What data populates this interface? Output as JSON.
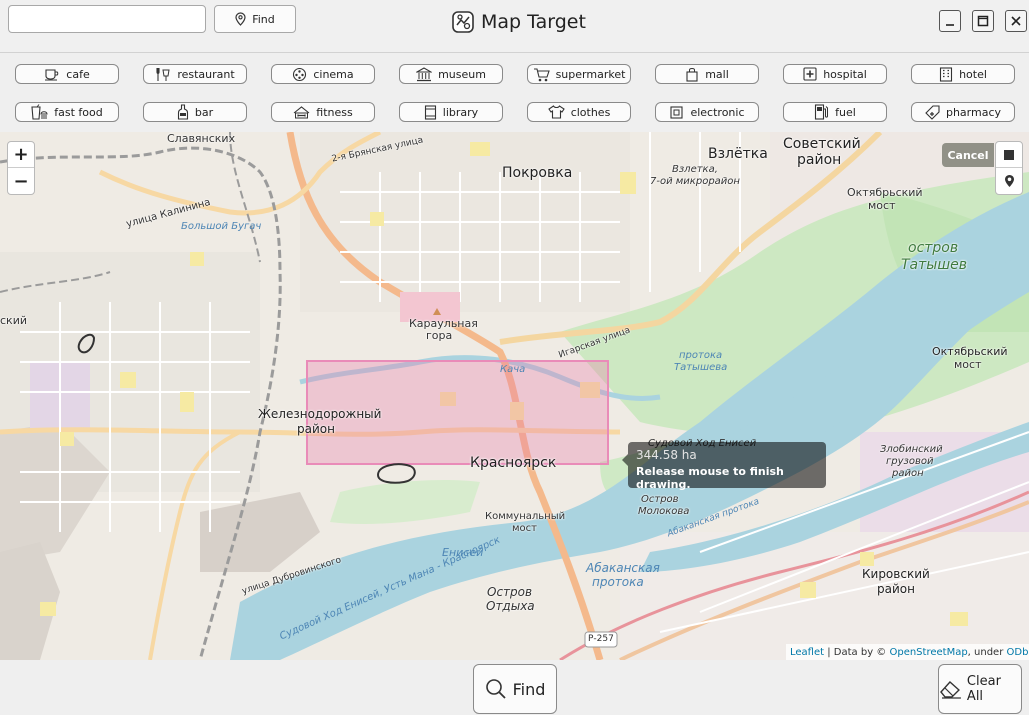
{
  "app": {
    "title": "Map Target"
  },
  "search": {
    "value": "",
    "placeholder": "",
    "find_label": "Find"
  },
  "categories": [
    {
      "label": "cafe",
      "icon": "cup-icon"
    },
    {
      "label": "restaurant",
      "icon": "cutlery-icon"
    },
    {
      "label": "cinema",
      "icon": "film-reel-icon"
    },
    {
      "label": "museum",
      "icon": "museum-icon"
    },
    {
      "label": "supermarket",
      "icon": "shopping-cart-icon"
    },
    {
      "label": "mall",
      "icon": "shopping-bag-icon"
    },
    {
      "label": "hospital",
      "icon": "medical-cross-icon"
    },
    {
      "label": "hotel",
      "icon": "building-icon"
    },
    {
      "label": "fast food",
      "icon": "burger-drink-icon"
    },
    {
      "label": "bar",
      "icon": "bottle-icon"
    },
    {
      "label": "fitness",
      "icon": "dumbbell-icon"
    },
    {
      "label": "library",
      "icon": "book-icon"
    },
    {
      "label": "clothes",
      "icon": "tshirt-icon"
    },
    {
      "label": "electronic",
      "icon": "chip-icon"
    },
    {
      "label": "fuel",
      "icon": "fuel-pump-icon"
    },
    {
      "label": "pharmacy",
      "icon": "pill-icon"
    }
  ],
  "map": {
    "zoom_in": "+",
    "zoom_out": "−",
    "cancel_label": "Cancel",
    "tooltip": {
      "area": "344.58 ha",
      "hint": "Release mouse to finish drawing."
    },
    "attribution": {
      "leaflet": "Leaflet",
      "sep": " | Data by © ",
      "osm": "OpenStreetMap",
      "under": ", under ",
      "odbl": "ODbL."
    },
    "labels": {
      "slavyansky": "Славянских",
      "bryanskaya": "2-я Брянская улица",
      "vzlyotka": "Взлётка",
      "sovetsky": "Советский",
      "rayon": "район",
      "pokrovka": "Покровка",
      "vzletka2": "Взлетка,",
      "mkr7": "7-ой микрорайон",
      "oktyabr_most": "Октябрьский",
      "most": "мост",
      "kalinina": "улица Калинина",
      "bugach": "Большой Бугач",
      "ostrov": "остров",
      "tatyshev": "Татышев",
      "karaulnaya": "Караульная",
      "gora": "гора",
      "igarskaya": "Игарская улица",
      "kacha": "Кача",
      "protoka": "протока",
      "tatysheva": "Татышева",
      "sky": "ский",
      "zheldor": "Железнодорожный",
      "zheldor2": "район",
      "krasnoyarsk": "Красноярск",
      "sudovoy": "Судовой Ход Енисей",
      "zlobinsky": "Злобинский",
      "gruzovoy": "грузовой",
      "rayon3": "район",
      "ostrov_molokova": "Остров",
      "molokova": "Молокова",
      "kommunalny": "Коммунальный",
      "most2": "мост",
      "abakanskaya": "Абаканская протока",
      "enisey": "Енисей",
      "dubrovinskogo": "улица Дубровинского",
      "sudovoy2": "Судовой Ход Енисей, Усть Мана - Красноярск",
      "abakanskaya2": "Абаканская",
      "protoka2": "протока",
      "ostrov_otdyha": "Остров",
      "otdyha": "Отдыха",
      "kirovsky": "Кировский",
      "kirovsky2": "район",
      "r257": "Р-257"
    }
  },
  "bottom": {
    "find_label": "Find",
    "clear_label": "Clear All"
  }
}
